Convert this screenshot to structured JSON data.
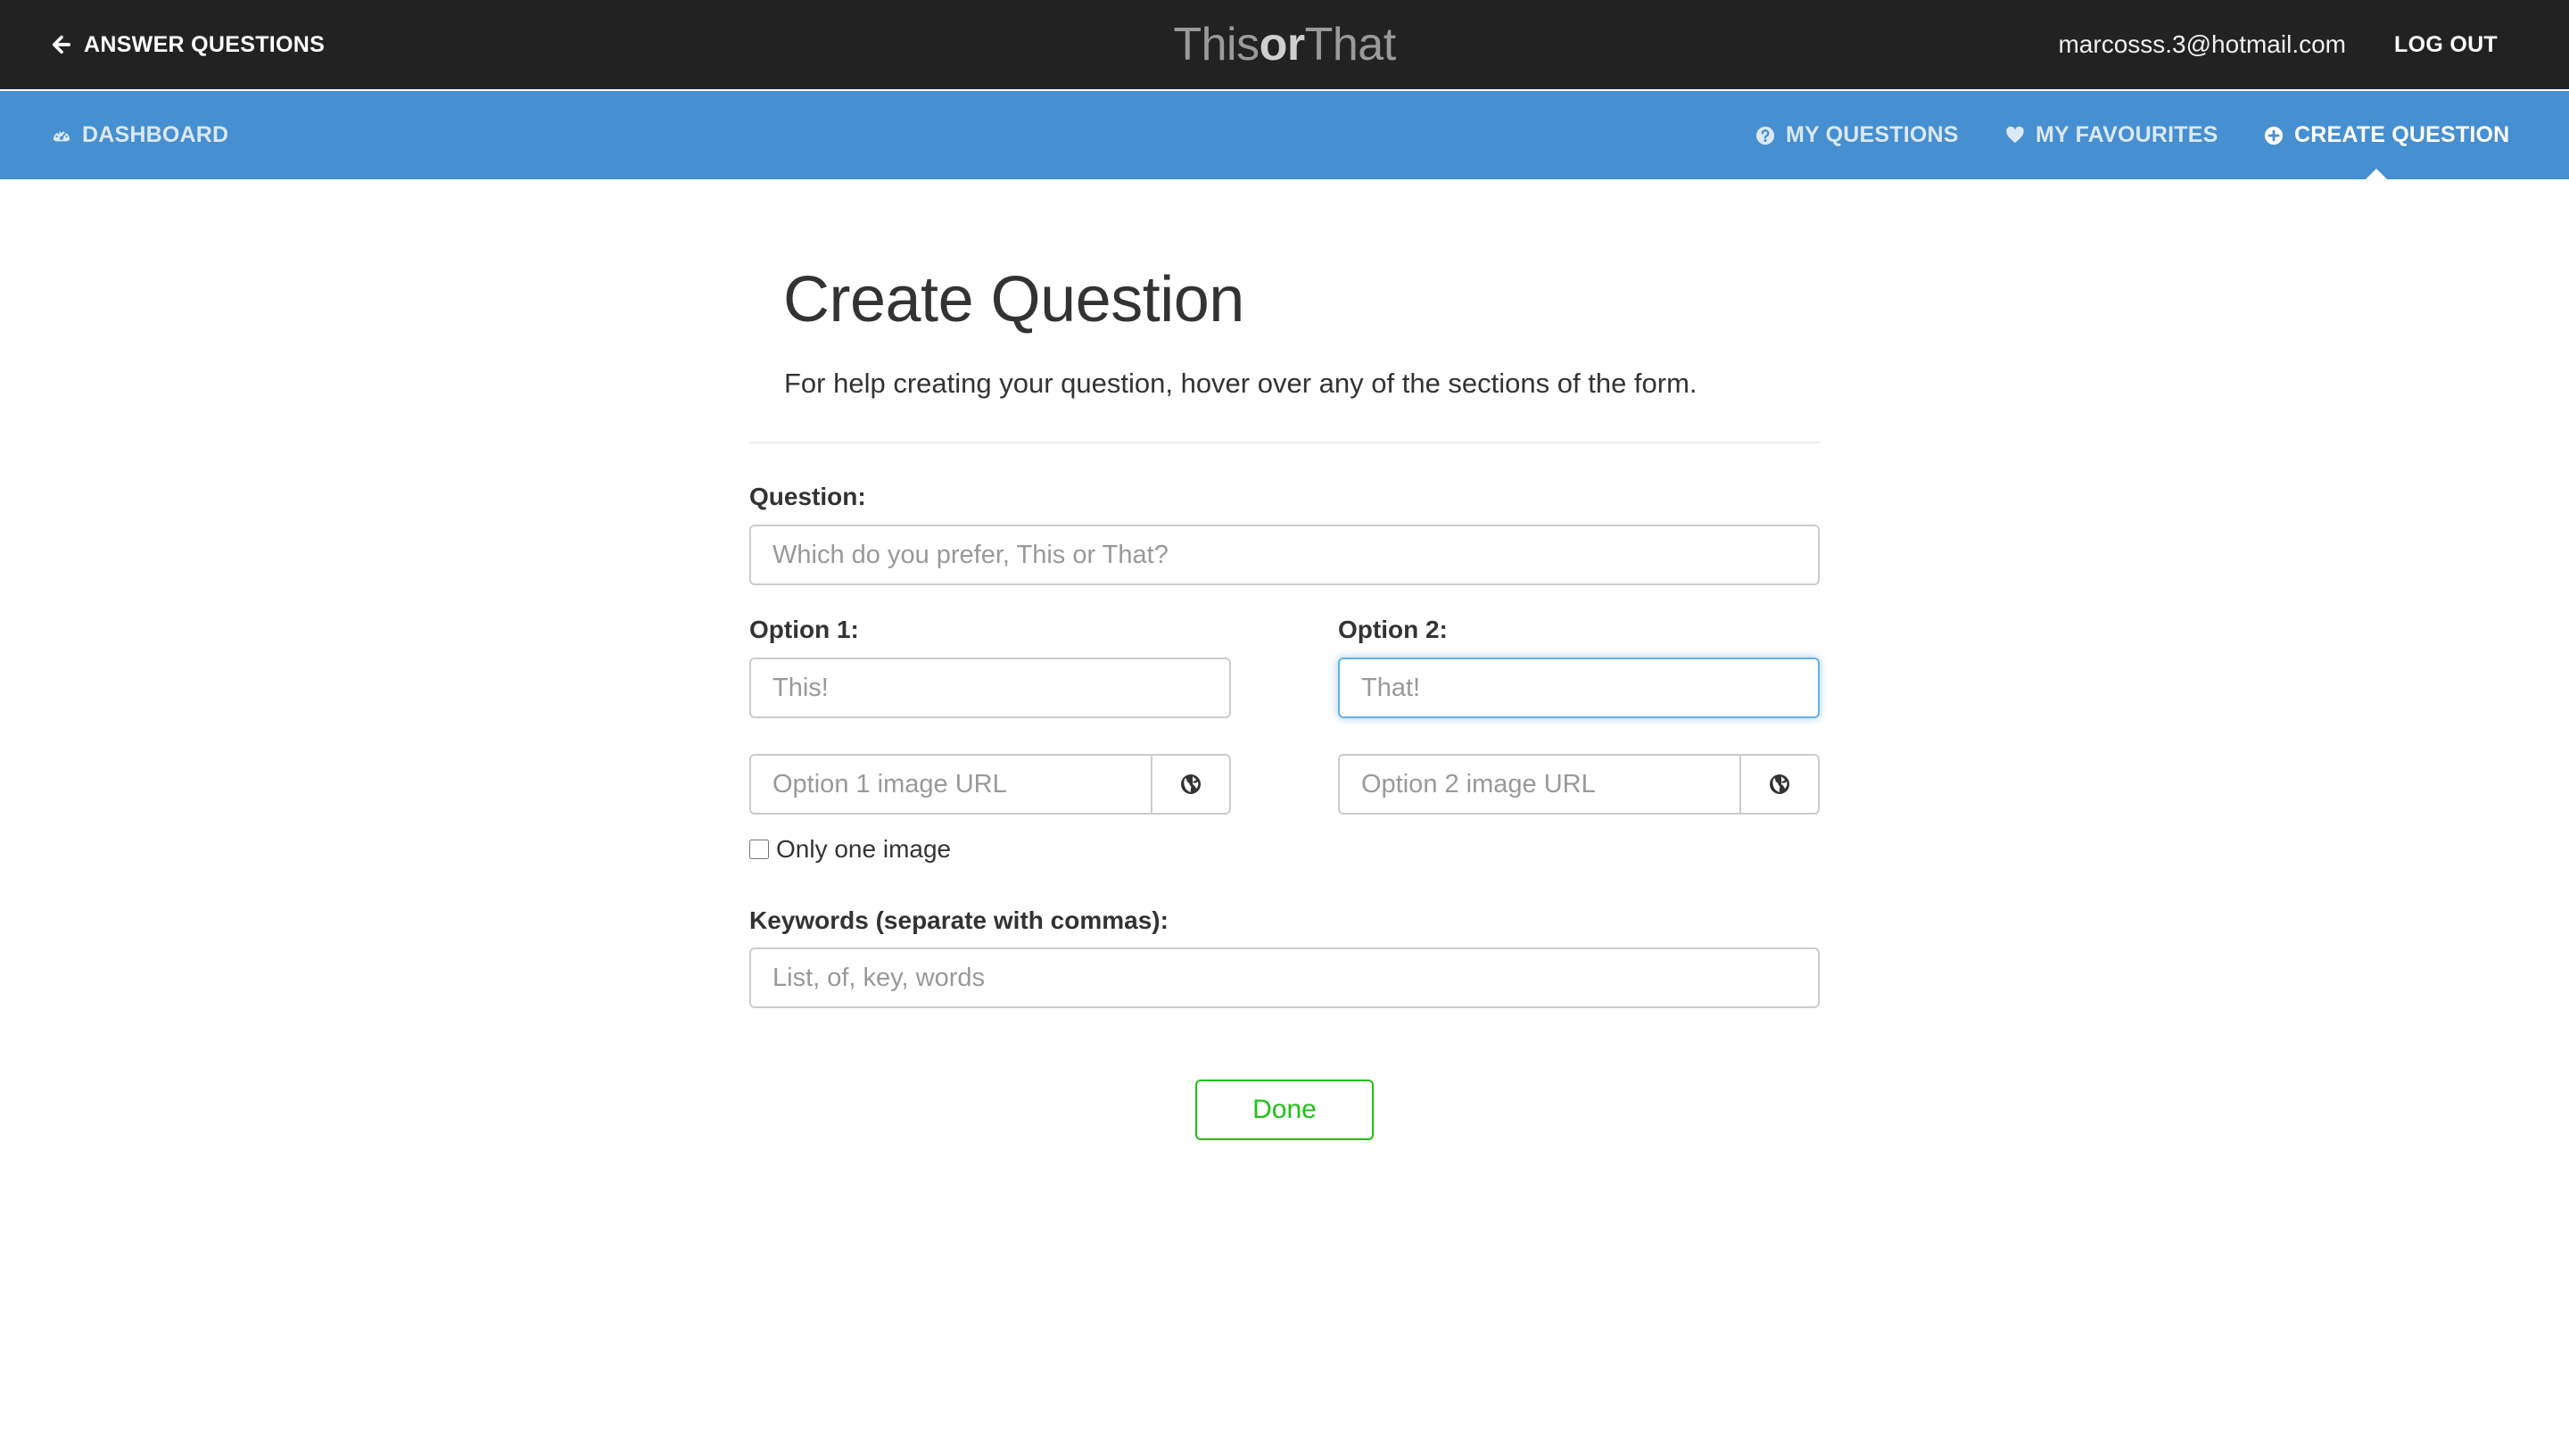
{
  "topbar": {
    "back_label": "ANSWER QUESTIONS",
    "brand_this": "This",
    "brand_or": "or",
    "brand_that": "That",
    "user_email": "marcosss.3@hotmail.com",
    "logout_label": "LOG OUT"
  },
  "navbar": {
    "dashboard_label": "DASHBOARD",
    "my_questions_label": "MY QUESTIONS",
    "my_favourites_label": "MY FAVOURITES",
    "create_question_label": "CREATE QUESTION",
    "active_item": "CREATE QUESTION"
  },
  "main": {
    "title": "Create Question",
    "subtitle": "For help creating your question, hover over any of the sections of the form."
  },
  "form": {
    "question_label": "Question:",
    "question_placeholder": "Which do you prefer, This or That?",
    "question_value": "",
    "option1_label": "Option 1:",
    "option1_placeholder": "This!",
    "option1_value": "",
    "option2_label": "Option 2:",
    "option2_placeholder": "That!",
    "option2_value": "",
    "option1_image_placeholder": "Option 1 image URL",
    "option2_image_placeholder": "Option 2 image URL",
    "only_one_image_label": "Only one image",
    "only_one_image_checked": false,
    "keywords_label": "Keywords (separate with commas):",
    "keywords_placeholder": "List, of, key, words",
    "keywords_value": "",
    "done_label": "Done"
  },
  "colors": {
    "topbar_bg": "#222222",
    "navbar_bg": "#468fd0",
    "done_green": "#1dc116",
    "focus_blue": "#66afe9"
  },
  "icons": {
    "back": "arrow-left-icon",
    "dashboard": "dashboard-gauge-icon",
    "my_questions": "question-circle-icon",
    "my_favourites": "heart-icon",
    "create_question": "plus-circle-icon",
    "image_url_addon": "globe-icon"
  }
}
